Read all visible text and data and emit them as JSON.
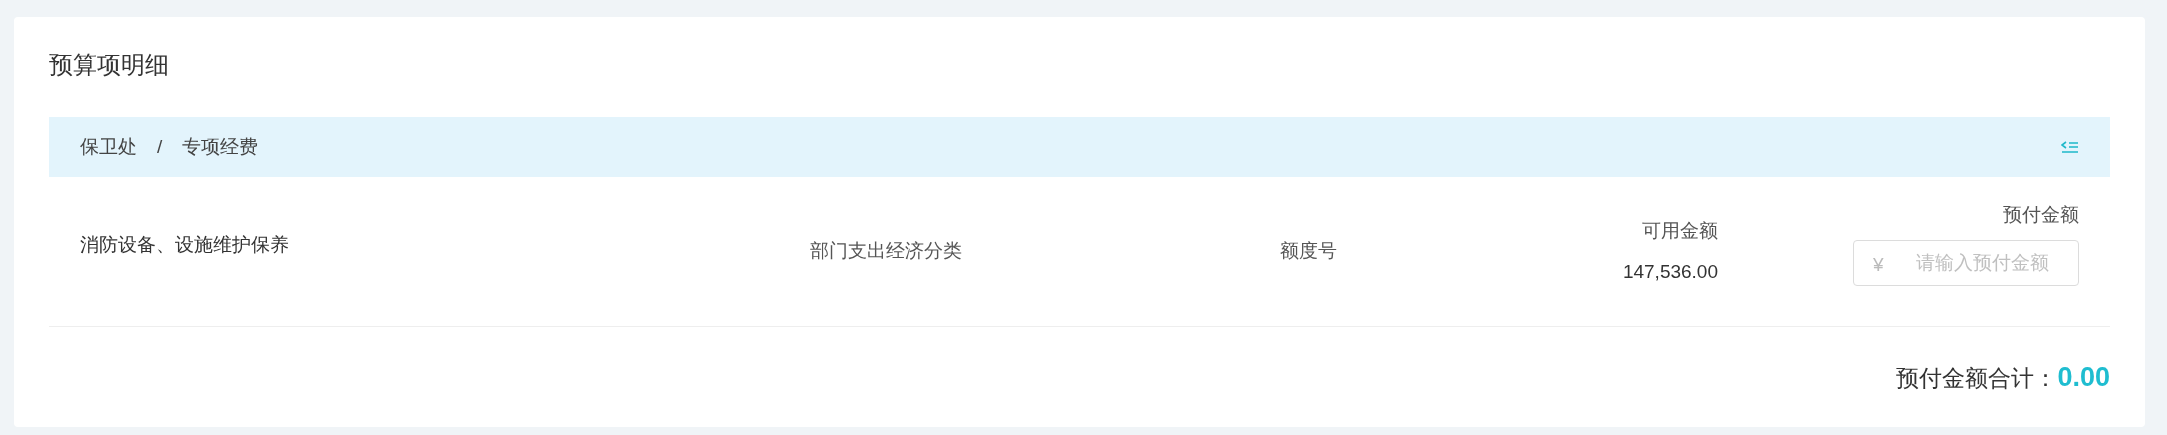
{
  "title": "预算项明细",
  "breadcrumb": [
    "保卫处",
    "专项经费"
  ],
  "breadcrumb_separator": "/",
  "items": [
    {
      "name": "消防设备、设施维护保养",
      "category": "部门支出经济分类",
      "quota": "额度号",
      "available_label": "可用金额",
      "available": "147,536.00",
      "prepay_label": "预付金额",
      "currency": "¥",
      "prepay_placeholder": "请输入预付金额"
    }
  ],
  "total": {
    "label": "预付金额合计：",
    "value": "0.00"
  }
}
